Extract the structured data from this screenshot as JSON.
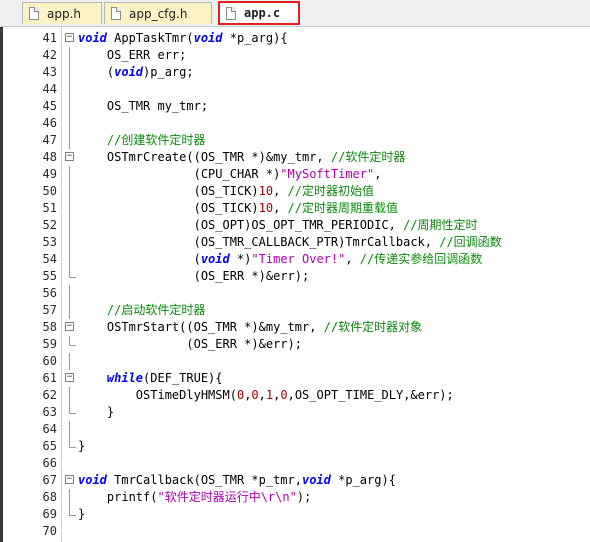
{
  "tabs": [
    {
      "label": "app.h",
      "active": false
    },
    {
      "label": "app_cfg.h",
      "active": false
    },
    {
      "label": "app.c",
      "active": true
    }
  ],
  "lines": [
    {
      "n": "41",
      "fold": "box",
      "parts": [
        [
          "kw",
          "void"
        ],
        [
          "t",
          " AppTaskTmr("
        ],
        [
          "kw",
          "void"
        ],
        [
          "t",
          " *p_arg){"
        ]
      ]
    },
    {
      "n": "42",
      "fold": "bar",
      "parts": [
        [
          "t",
          "    OS_ERR err;"
        ]
      ]
    },
    {
      "n": "43",
      "fold": "bar",
      "parts": [
        [
          "t",
          "    ("
        ],
        [
          "kw",
          "void"
        ],
        [
          "t",
          ")p_arg;"
        ]
      ]
    },
    {
      "n": "44",
      "fold": "bar",
      "parts": []
    },
    {
      "n": "45",
      "fold": "bar",
      "parts": [
        [
          "t",
          "    OS_TMR my_tmr;"
        ]
      ]
    },
    {
      "n": "46",
      "fold": "bar",
      "parts": []
    },
    {
      "n": "47",
      "fold": "bar",
      "parts": [
        [
          "t",
          "    "
        ],
        [
          "cm",
          "//创建软件定时器"
        ]
      ]
    },
    {
      "n": "48",
      "fold": "box",
      "parts": [
        [
          "t",
          "    OSTmrCreate((OS_TMR *)&my_tmr, "
        ],
        [
          "cm",
          "//软件定时器"
        ]
      ]
    },
    {
      "n": "49",
      "fold": "bar",
      "parts": [
        [
          "t",
          "                (CPU_CHAR *)"
        ],
        [
          "st",
          "\"MySoftTimer\""
        ],
        [
          "t",
          ","
        ]
      ]
    },
    {
      "n": "50",
      "fold": "bar",
      "parts": [
        [
          "t",
          "                (OS_TICK)"
        ],
        [
          "nm",
          "10"
        ],
        [
          "t",
          ", "
        ],
        [
          "cm",
          "//定时器初始值"
        ]
      ]
    },
    {
      "n": "51",
      "fold": "bar",
      "parts": [
        [
          "t",
          "                (OS_TICK)"
        ],
        [
          "nm",
          "10"
        ],
        [
          "t",
          ", "
        ],
        [
          "cm",
          "//定时器周期重载值"
        ]
      ]
    },
    {
      "n": "52",
      "fold": "bar",
      "parts": [
        [
          "t",
          "                (OS_OPT)OS_OPT_TMR_PERIODIC, "
        ],
        [
          "cm",
          "//周期性定时"
        ]
      ]
    },
    {
      "n": "53",
      "fold": "bar",
      "parts": [
        [
          "t",
          "                (OS_TMR_CALLBACK_PTR)TmrCallback, "
        ],
        [
          "cm",
          "//回调函数"
        ]
      ]
    },
    {
      "n": "54",
      "fold": "bar",
      "parts": [
        [
          "t",
          "                ("
        ],
        [
          "kw",
          "void"
        ],
        [
          "t",
          " *)"
        ],
        [
          "st",
          "\"Timer Over!\""
        ],
        [
          "t",
          ", "
        ],
        [
          "cm",
          "//传递实参给回调函数"
        ]
      ]
    },
    {
      "n": "55",
      "fold": "end",
      "parts": [
        [
          "t",
          "                (OS_ERR *)&err);"
        ]
      ]
    },
    {
      "n": "56",
      "fold": "bar",
      "parts": []
    },
    {
      "n": "57",
      "fold": "bar",
      "parts": [
        [
          "t",
          "    "
        ],
        [
          "cm",
          "//启动软件定时器"
        ]
      ]
    },
    {
      "n": "58",
      "fold": "box",
      "parts": [
        [
          "t",
          "    OSTmrStart((OS_TMR *)&my_tmr, "
        ],
        [
          "cm",
          "//软件定时器对象"
        ]
      ]
    },
    {
      "n": "59",
      "fold": "end",
      "parts": [
        [
          "t",
          "               (OS_ERR *)&err);"
        ]
      ]
    },
    {
      "n": "60",
      "fold": "bar",
      "parts": []
    },
    {
      "n": "61",
      "fold": "box",
      "parts": [
        [
          "t",
          "    "
        ],
        [
          "kw",
          "while"
        ],
        [
          "t",
          "(DEF_TRUE){"
        ]
      ]
    },
    {
      "n": "62",
      "fold": "bar",
      "parts": [
        [
          "t",
          "        OSTimeDlyHMSM("
        ],
        [
          "nm",
          "0"
        ],
        [
          "t",
          ","
        ],
        [
          "nm",
          "0"
        ],
        [
          "t",
          ","
        ],
        [
          "nm",
          "1"
        ],
        [
          "t",
          ","
        ],
        [
          "nm",
          "0"
        ],
        [
          "t",
          ",OS_OPT_TIME_DLY,&err);"
        ]
      ]
    },
    {
      "n": "63",
      "fold": "end",
      "parts": [
        [
          "t",
          "    }"
        ]
      ]
    },
    {
      "n": "64",
      "fold": "bar",
      "parts": []
    },
    {
      "n": "65",
      "fold": "end",
      "parts": [
        [
          "t",
          "}"
        ]
      ]
    },
    {
      "n": "66",
      "fold": "none",
      "parts": []
    },
    {
      "n": "67",
      "fold": "box",
      "parts": [
        [
          "kw",
          "void"
        ],
        [
          "t",
          " TmrCallback(OS_TMR *p_tmr,"
        ],
        [
          "kw",
          "void"
        ],
        [
          "t",
          " *p_arg){"
        ]
      ]
    },
    {
      "n": "68",
      "fold": "bar",
      "parts": [
        [
          "t",
          "    printf("
        ],
        [
          "st",
          "\"软件定时器运行中\\r\\n\""
        ],
        [
          "t",
          ");"
        ]
      ]
    },
    {
      "n": "69",
      "fold": "end",
      "parts": [
        [
          "t",
          "}"
        ]
      ]
    },
    {
      "n": "70",
      "fold": "none",
      "parts": []
    }
  ]
}
